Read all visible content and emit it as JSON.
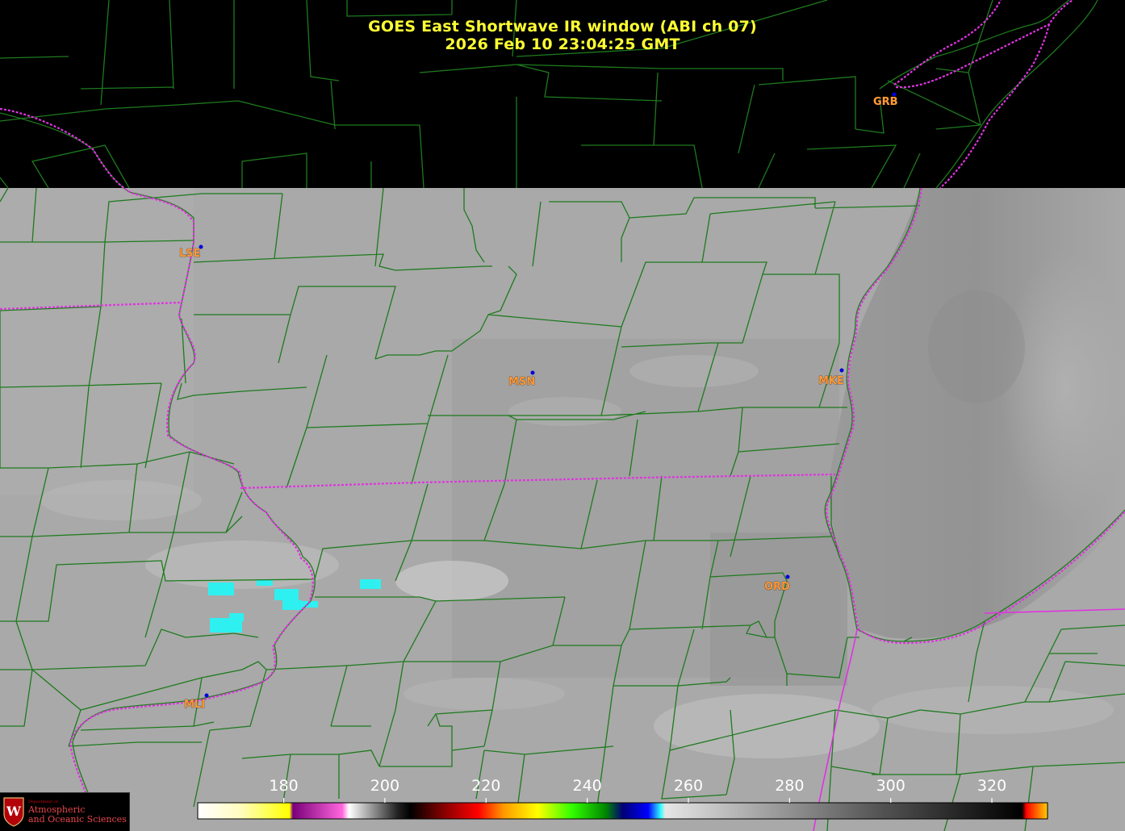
{
  "title": {
    "line1": "GOES East Shortwave IR window (ABI ch 07)",
    "line2": "2026 Feb 10  23:04:25 GMT"
  },
  "colors": {
    "title": "#ffff33",
    "county_lines": "#1e7a1e",
    "state_lines": "#e033e0",
    "station_dot": "#0000dd",
    "station_label": "#ff9a3a",
    "cold_cloud": "#2ff0f0"
  },
  "stations": [
    {
      "id": "GRB",
      "label": "GRB"
    },
    {
      "id": "LSE",
      "label": "LSE"
    },
    {
      "id": "MSN",
      "label": "MSN"
    },
    {
      "id": "MKE",
      "label": "MKE"
    },
    {
      "id": "ORD",
      "label": "ORD"
    },
    {
      "id": "MLI",
      "label": "MLI"
    }
  ],
  "colorbar": {
    "ticks": [
      "180",
      "200",
      "220",
      "240",
      "260",
      "280",
      "300",
      "320"
    ],
    "tick_values": [
      180,
      200,
      220,
      240,
      260,
      280,
      300,
      320
    ],
    "min": 163,
    "max": 331
  },
  "logo": {
    "dept": "Department of",
    "name1": "Atmospheric",
    "name2": "and Oceanic Sciences",
    "crest_letter": "W"
  }
}
